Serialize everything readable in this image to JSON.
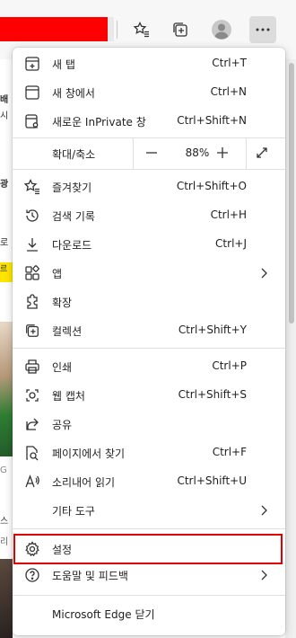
{
  "toolbar": {
    "favorites_icon": "star-list-icon",
    "collections_icon": "collections-icon",
    "profile_icon": "profile-icon",
    "menu_icon": "more-dots-icon",
    "address_color": "#ff0000"
  },
  "background_fragments": [
    "배",
    "시",
    "광",
    "로",
    "르",
    "G",
    "스",
    "리"
  ],
  "menu": {
    "items_top": [
      {
        "label": "새 탭",
        "shortcut": "Ctrl+T",
        "icon": "new-tab-icon"
      },
      {
        "label": "새 창에서",
        "shortcut": "Ctrl+N",
        "icon": "new-window-icon"
      },
      {
        "label": "새로운 InPrivate 창",
        "shortcut": "Ctrl+Shift+N",
        "icon": "inprivate-icon"
      }
    ],
    "zoom": {
      "label": "확대/축소",
      "value": "88%",
      "minus": "−",
      "plus": "+"
    },
    "items_mid": [
      {
        "label": "즐겨찾기",
        "shortcut": "Ctrl+Shift+O",
        "icon": "favorites-icon"
      },
      {
        "label": "검색 기록",
        "shortcut": "Ctrl+H",
        "icon": "history-icon"
      },
      {
        "label": "다운로드",
        "shortcut": "Ctrl+J",
        "icon": "download-icon"
      },
      {
        "label": "앱",
        "shortcut": "",
        "icon": "apps-icon"
      },
      {
        "label": "확장",
        "shortcut": "",
        "icon": "extensions-icon"
      },
      {
        "label": "컬렉션",
        "shortcut": "Ctrl+Shift+Y",
        "icon": "collections-icon"
      }
    ],
    "items_tools": [
      {
        "label": "인쇄",
        "shortcut": "Ctrl+P",
        "icon": "print-icon"
      },
      {
        "label": "웹 캡처",
        "shortcut": "Ctrl+Shift+S",
        "icon": "web-capture-icon"
      },
      {
        "label": "공유",
        "shortcut": "",
        "icon": "share-icon"
      },
      {
        "label": "페이지에서 찾기",
        "shortcut": "Ctrl+F",
        "icon": "find-icon"
      },
      {
        "label": "소리내어 읽기",
        "shortcut": "Ctrl+Shift+U",
        "icon": "read-aloud-icon"
      },
      {
        "label": "기타 도구",
        "shortcut": "",
        "icon": ""
      }
    ],
    "settings": {
      "label": "설정",
      "icon": "gear-icon"
    },
    "help": {
      "label": "도움말 및 피드백",
      "icon": "help-icon"
    },
    "close": {
      "label": "Microsoft Edge 닫기"
    },
    "highlight_color": "#e00000"
  }
}
